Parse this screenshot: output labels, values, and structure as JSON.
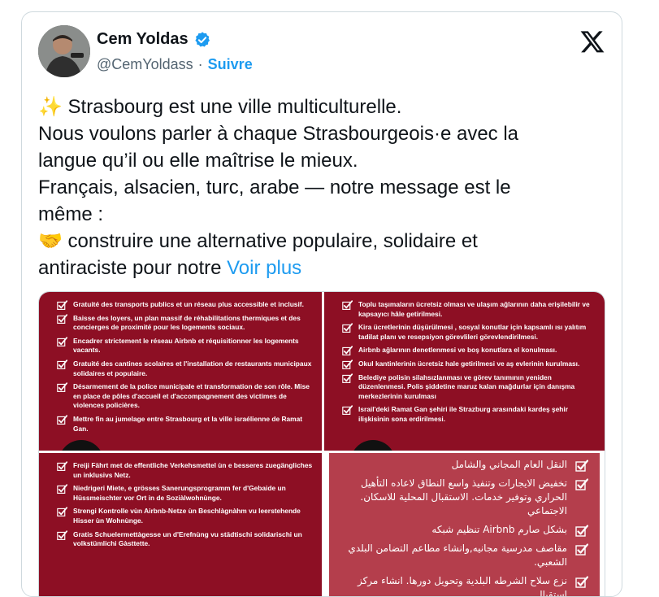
{
  "author": {
    "name": "Cem Yoldas",
    "handle": "@CemYoldass",
    "follow_label": "Suivre",
    "verified_icon": "verified-badge-icon"
  },
  "platform_logo": "x-logo-icon",
  "tweet": {
    "lines": [
      "✨ Strasbourg est une ville multiculturelle.",
      "Nous voulons parler à chaque Strasbourgeois·e avec la",
      "langue qu’il ou elle maîtrise le mieux.",
      "Français, alsacien, turc, arabe — notre message est le",
      "même :",
      "🤝 construire une alternative populaire, solidaire et"
    ],
    "last_line": "antiraciste pour notre ",
    "more_label": "Voir plus"
  },
  "media": {
    "french": [
      "Gratuité des transports publics et un réseau plus accessible et inclusif.",
      "Baisse des loyers, un plan massif de réhabilitations thermiques et des concierges de proximité pour les logements sociaux.",
      "Encadrer strictement le réseau Airbnb et réquisitionner les logements vacants.",
      "Gratuité des cantines scolaires et l'installation de restaurants municipaux solidaires et populaire.",
      "Désarmement de la police municipale et transformation de son rôle. Mise en place de pôles d'accueil et d'accompagnement des victimes de violences policières.",
      "Mettre fin au jumelage entre Strasbourg et la ville israélienne de Ramat Gan."
    ],
    "turkish": [
      "Toplu taşımaların ücretsiz olması ve ulaşım ağlarının daha erişilebilir ve kapsayıcı hâle getirilmesi.",
      "Kira ücretlerinin düşürülmesi , sosyal konutlar için kapsamlı ısı yalıtım tadilat planı ve resepsiyon görevlileri görevlendirilmesi.",
      "Airbnb ağlarının denetlenmesi ve boş konutlara el konulması.",
      "Okul kantinlerinin ücretsiz hale getirilmesi ve aş evlerinin kurulması.",
      "Belediye polisin silahsızlanması ve görev tanımının yeniden düzenlenmesi. Polis şiddetine maruz kalan mağdurlar için danışma merkezlerinin kurulması",
      "Israil'deki Ramat Gan şehiri ile Strazburg arasındaki kardeş şehir ilişkisinin sona erdirilmesi."
    ],
    "alsatian": [
      "Freiji Fährt met de effentliche Verkehsmettel ùn e besseres zuegängliches un inklusivs Netz.",
      "Niedrigeri Miete, e grösses Sanerungsprogramm fer d'Gebaide un Hüssmeischter vor Ort in de Soziàlwohnùnge.",
      "Strengi Kontrolle vùn Airbnb-Netze ùn Beschlàgnàhm vu leerstehende Hisser ùn Wohnùnge.",
      "Gratis Schuelermettàgesse un d'Erefnùng vu städtischi solidarischi un volkstümlichi Gàsttette."
    ],
    "arabic": [
      "النقل العام المجاني والشامل",
      "تخفيض الايجارات وتنفيذ واسع النطاق لاعاده التأهيل الحراري وتوفير خدمات. الاستقبال المحلية للاسكان. الاجتماعي",
      "بشكل صارم Airbnb تنظيم شبكه",
      "مقاصف مدرسية مجانيه,وانشاء مطاعم التضامن البلدي الشعبي.",
      "نزع سلاح الشرطه البلدية وتحويل دورها. انشاء مركز استقبال"
    ]
  }
}
